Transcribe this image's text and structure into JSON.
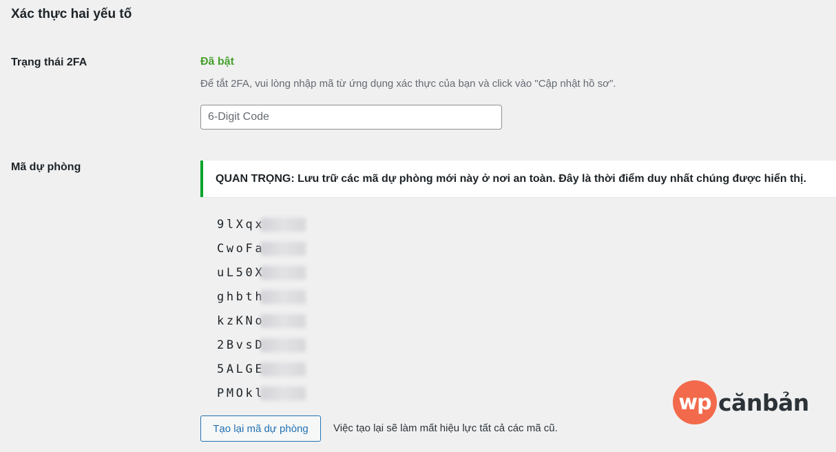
{
  "section": {
    "title": "Xác thực hai yếu tố"
  },
  "status_row": {
    "label": "Trạng thái 2FA",
    "status": "Đã bật",
    "status_color": "#46a02c",
    "description": "Để tắt 2FA, vui lòng nhập mã từ ứng dụng xác thực của bạn và click vào \"Cập nhật hồ sơ\".",
    "input": {
      "placeholder": "6-Digit Code",
      "value": ""
    }
  },
  "backup_row": {
    "label": "Mã dự phòng",
    "notice": {
      "text": "QUAN TRỌNG: Lưu trữ các mã dự phòng mới này ở nơi an toàn. Đây là thời điểm duy nhất chúng được hiển thị.",
      "border_color": "#00a32a"
    },
    "codes": [
      "9lXqx",
      "CwoFa",
      "uL50X",
      "ghbth",
      "kzKNo",
      "2BvsD",
      "5ALGE",
      "PMOkl"
    ],
    "regenerate_button": "Tạo lại mã dự phòng",
    "regenerate_note": "Việc tạo lại sẽ làm mất hiệu lực tất cả các mã cũ."
  },
  "watermark": {
    "logo_text": "wp",
    "brand_text": "cănbản",
    "logo_color": "#f26a4b"
  },
  "colors": {
    "background": "#f0f0f1",
    "button_accent": "#2271b1"
  }
}
